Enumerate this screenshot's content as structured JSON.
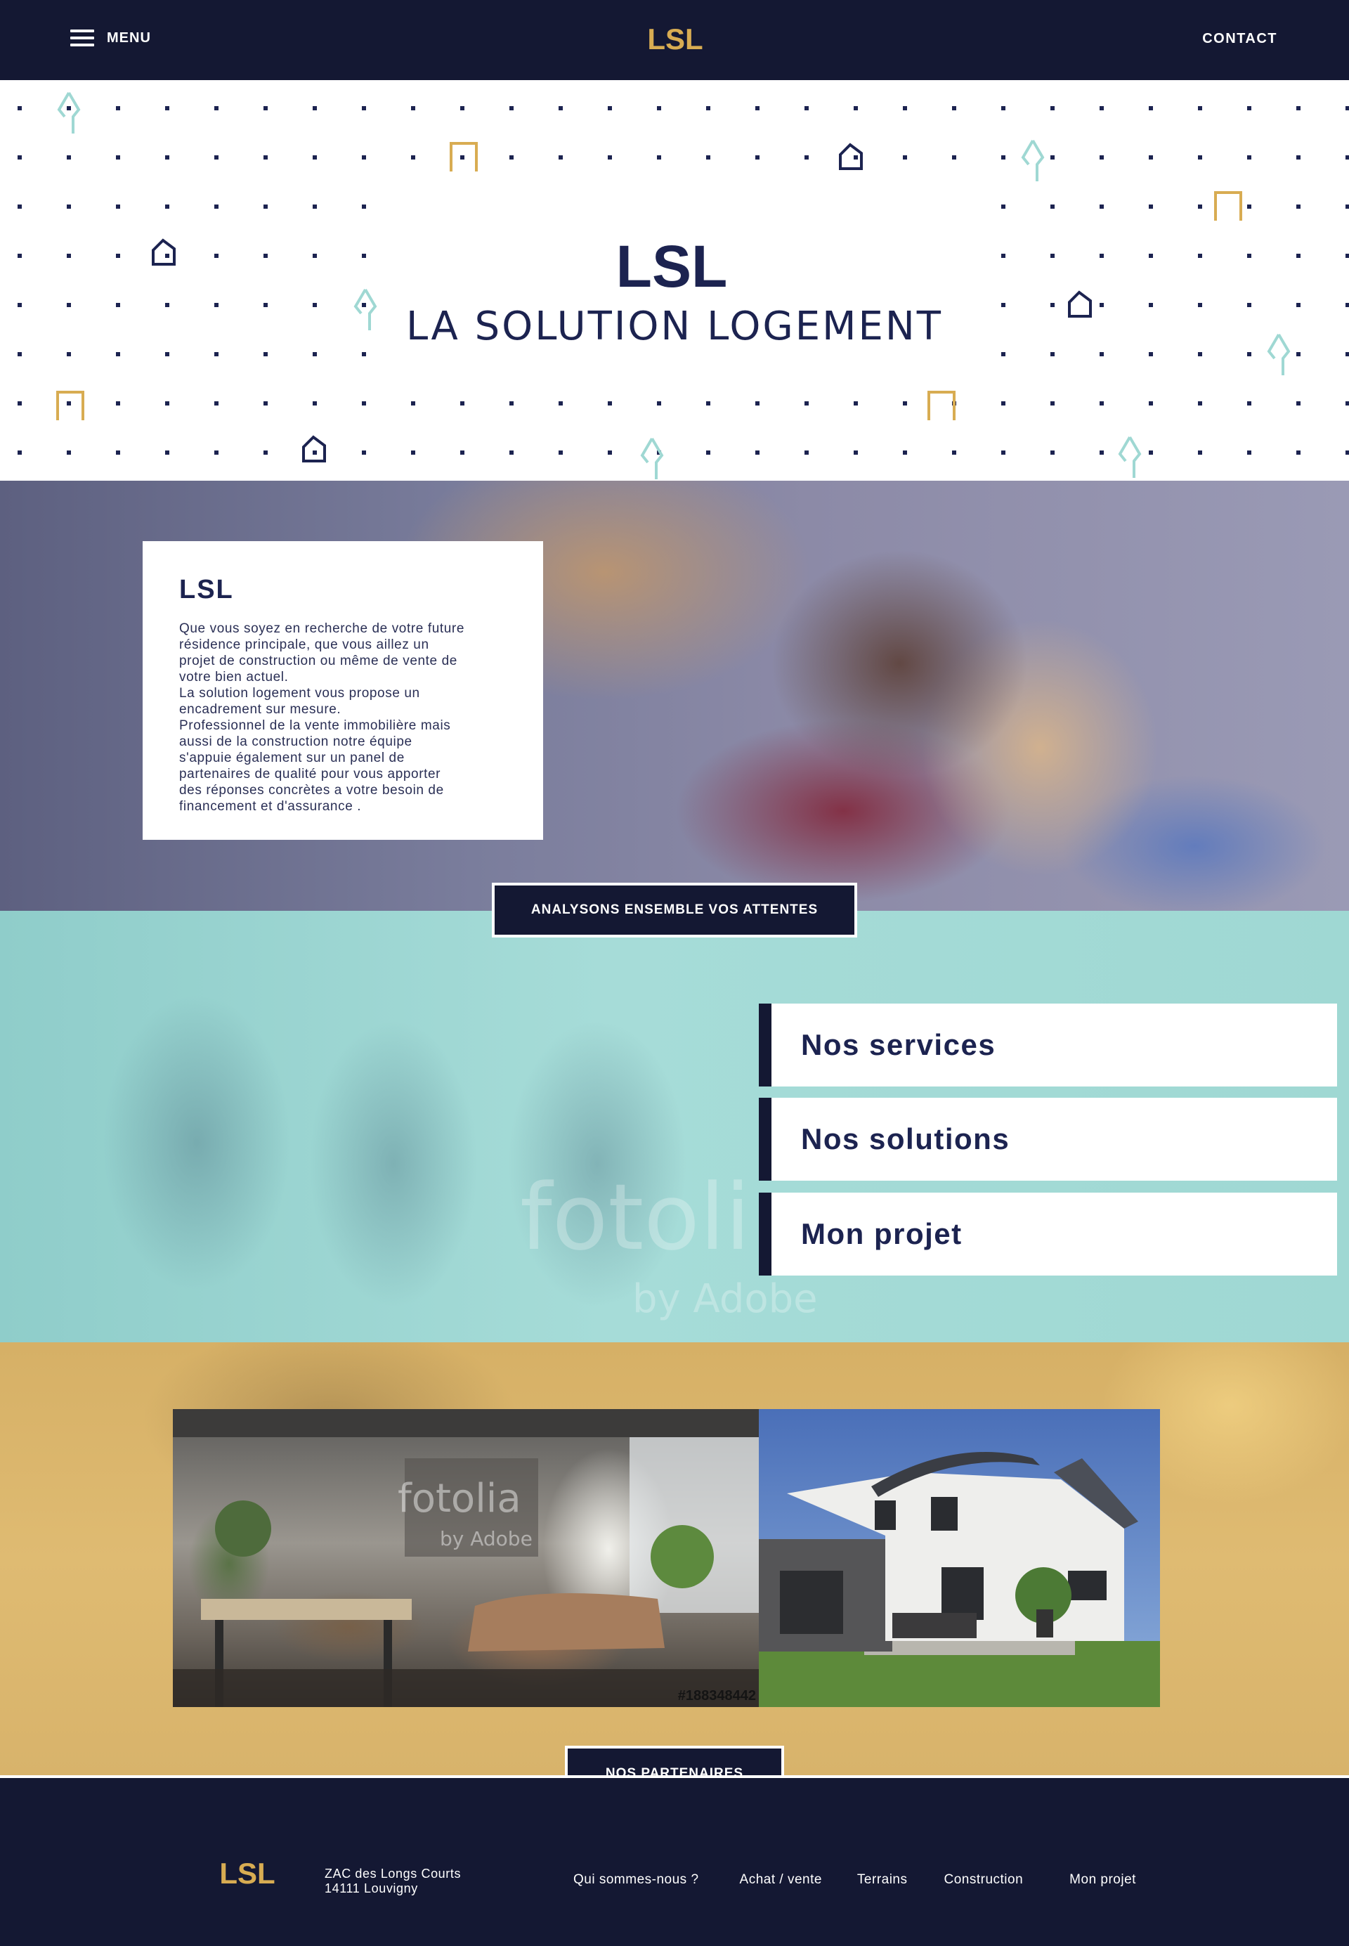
{
  "header": {
    "menu_label": "MENU",
    "contact_label": "CONTACT",
    "logo_text": "LSL"
  },
  "hero": {
    "logo_text": "LSL",
    "title": "LA SOLUTION LOGEMENT"
  },
  "intro": {
    "title": "LSL",
    "text": "Que vous soyez en recherche de votre future\nrésidence principale, que vous aillez un\nprojet de construction ou même de vente de\nvotre bien actuel.\nLa solution logement vous propose un\nencadrement sur mesure.\nProfessionnel de la vente immobilière mais\naussi de la construction notre équipe\ns'appuie également sur un panel de\npartenaires de qualité pour vous apporter\ndes réponses concrètes a votre besoin de\nfinancement et d'assurance ."
  },
  "cta_expectations": "ANALYSONS ENSEMBLE VOS ATTENTES",
  "services": {
    "watermark_big": "fotoli",
    "watermark_small": "by Adobe",
    "items": [
      "Nos services",
      "Nos solutions",
      "Mon projet"
    ]
  },
  "gallery": {
    "interior_watermark": "fotolia",
    "interior_watermark_sub": "by Adobe",
    "interior_code": "#188348442"
  },
  "cta_partners": "NOS PARTENAIRES",
  "footer": {
    "logo_text": "LSL",
    "address_line1": "ZAC des Longs Courts",
    "address_line2": "14111 Louvigny",
    "links": [
      "Qui sommes-nous ?",
      "Achat / vente",
      "Terrains",
      "Construction",
      "Mon projet"
    ]
  },
  "colors": {
    "navy": "#141833",
    "title_navy": "#1c2350",
    "gold": "#d8ac52",
    "teal": "#9fd8d3"
  },
  "icons": [
    "menu-icon",
    "house-outline-icon",
    "tree-icon",
    "doorway-icon"
  ]
}
